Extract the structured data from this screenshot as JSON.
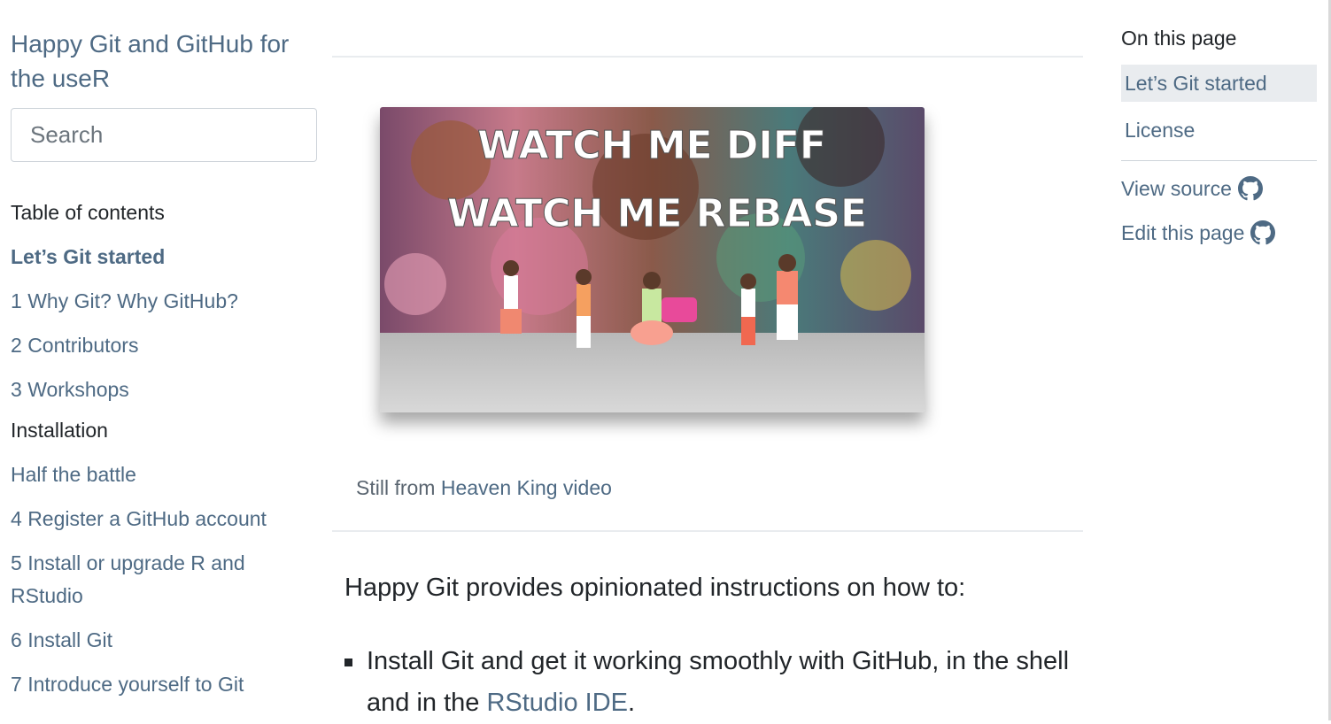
{
  "sidebar": {
    "title": "Happy Git and GitHub for the useR",
    "search_placeholder": "Search",
    "toc_heading": "Table of contents",
    "items": [
      {
        "num": "",
        "label": "Let’s Git started"
      },
      {
        "num": "1",
        "label": "Why Git? Why GitHub?"
      },
      {
        "num": "2",
        "label": "Contributors"
      },
      {
        "num": "3",
        "label": "Workshops"
      }
    ],
    "installation_heading": "Installation",
    "install_items": [
      {
        "num": "",
        "label": "Half the battle"
      },
      {
        "num": "4",
        "label": "Register a GitHub account"
      },
      {
        "num": "5",
        "label": "Install or upgrade R and RStudio"
      },
      {
        "num": "6",
        "label": "Install Git"
      },
      {
        "num": "7",
        "label": "Introduce yourself to Git"
      }
    ]
  },
  "figure": {
    "overlay_line1": "WATCH ME DIFF",
    "overlay_line2": "WATCH ME REBASE",
    "caption_prefix": "Still from ",
    "caption_link": "Heaven King video"
  },
  "content": {
    "intro": "Happy Git provides opinionated instructions on how to:",
    "bullet1_text": "Install Git and get it working smoothly with GitHub, in the shell and in the ",
    "bullet1_link": "RStudio IDE",
    "bullet1_end": "."
  },
  "onpage": {
    "title": "On this page",
    "items": [
      "Let’s Git started",
      "License"
    ],
    "view_source": "View source",
    "edit_page": "Edit this page"
  },
  "icons": {
    "github": "github-icon"
  },
  "colors": {
    "link": "#4e6a84",
    "text": "#212529",
    "active_bg": "#e9ecef"
  }
}
